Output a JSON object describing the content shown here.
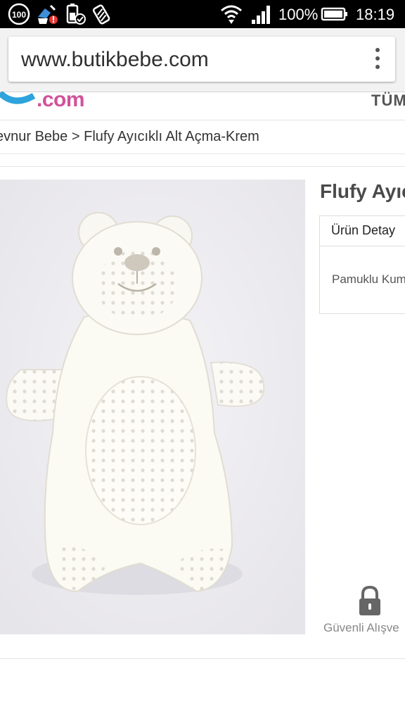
{
  "status_bar": {
    "notification_badge": "100",
    "battery_percent": "100%",
    "time": "18:19",
    "icons": [
      "hundred-badge-icon",
      "cleaner-alert-icon",
      "battery-saver-icon",
      "battery-mode-icon",
      "wifi-icon",
      "signal-icon",
      "battery-icon"
    ]
  },
  "browser": {
    "url": "www.butikbebe.com",
    "menu_icon": "overflow-menu-icon"
  },
  "header": {
    "logo_text": ".com",
    "nav_partial": "TÜM"
  },
  "breadcrumb": {
    "parent": "evnur Bebe",
    "separator": ">",
    "current": "Flufy Ayıcıklı Alt Açma-Krem"
  },
  "product": {
    "title": "Flufy Ayıcı",
    "tab_label": "Ürün Detay",
    "detail_text": "Pamuklu Kum",
    "secure_label": "Güvenli Alışve",
    "secure_icon": "lock-icon",
    "image_subject": "bear-changing-mat-image"
  },
  "colors": {
    "logo_pink": "#d0539b",
    "logo_blue": "#2ea3dc",
    "status_bar_bg": "#000000"
  }
}
